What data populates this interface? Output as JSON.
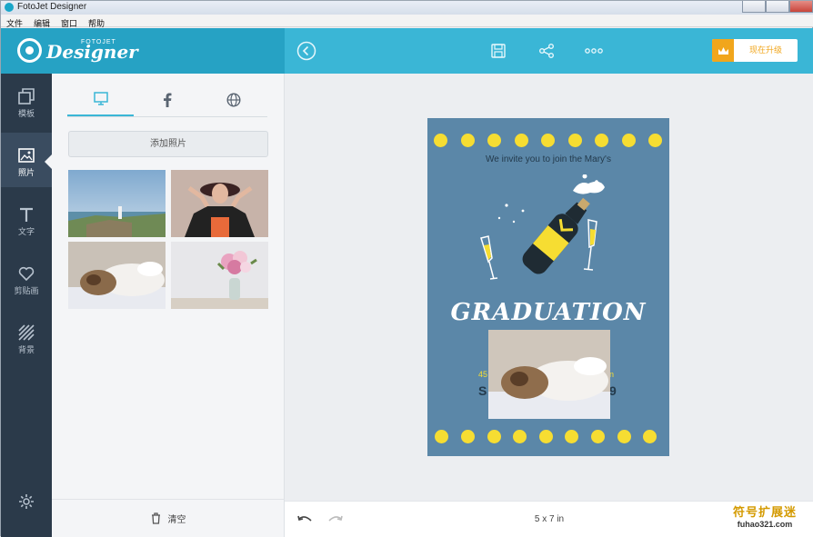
{
  "window": {
    "title": "FotoJet Designer"
  },
  "menu": [
    "文件",
    "编辑",
    "窗口",
    "帮助"
  ],
  "brand": {
    "name": "Designer",
    "small": "FOTOJET"
  },
  "header": {
    "upgrade_label": "现在升级"
  },
  "nav": [
    {
      "label": "模板",
      "icon": "template-icon"
    },
    {
      "label": "照片",
      "icon": "photo-icon"
    },
    {
      "label": "文字",
      "icon": "text-icon"
    },
    {
      "label": "剪贴画",
      "icon": "heart-icon"
    },
    {
      "label": "背景",
      "icon": "background-icon"
    }
  ],
  "panel": {
    "tabs": [
      "computer-icon",
      "facebook-icon",
      "web-icon"
    ],
    "add_photo_label": "添加照片",
    "thumbnails": [
      "lighthouse coast photo",
      "woman with hat photo",
      "sleeping cat photo",
      "flower vase photo"
    ],
    "clear_label": "清空"
  },
  "card": {
    "invite_text": "We invite you to join the Mary's",
    "title": "GRADUATION",
    "line1_left": "45",
    "line1_right": "n",
    "line2_left": "S",
    "line2_right": "9"
  },
  "bottom": {
    "size_label": "5 x 7 in"
  },
  "watermark": {
    "line1": "符号扩展迷",
    "line2": "fuhao321.com"
  },
  "colors": {
    "header": "#3ab6d6",
    "brand": "#26a2c4",
    "nav": "#2b3a4a",
    "card": "#5b87a8",
    "accent_yellow": "#f6dd32",
    "upgrade_orange": "#f1a61c"
  }
}
